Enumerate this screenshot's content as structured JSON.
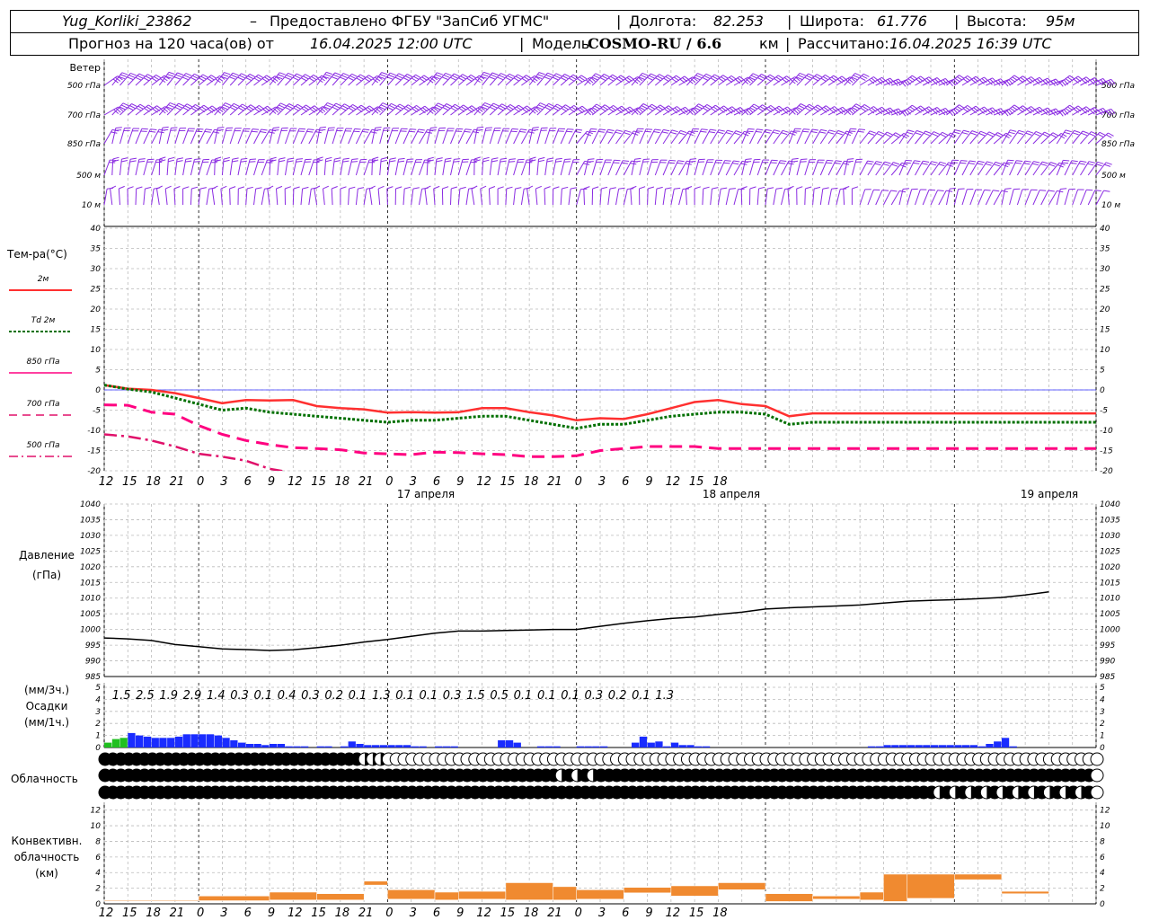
{
  "header": {
    "station": "Yug_Korliki_23862",
    "dash": "–",
    "provided_by": "Предоставлено ФГБУ \"ЗапСиб УГМС\"",
    "lon_label": "Долгота:",
    "lon_value": "82.253",
    "lat_label": "Широта:",
    "lat_value": "61.776",
    "alt_label": "Высота:",
    "alt_value": "95м",
    "forecast_label": "Прогноз на 120 часа(ов) от",
    "forecast_start": "16.04.2025 12:00 UTC",
    "model_label": "Модель",
    "model_name": "COSMO-RU / 6.6",
    "model_unit": "км",
    "computed_label": "Рассчитано:",
    "computed_value": "16.04.2025 16:39 UTC"
  },
  "colors": {
    "wind": "#8a2be2",
    "t2m": "#ff3030",
    "td2m": "#007000",
    "t850": "#ff0080",
    "t700": "#e0106a",
    "t500": "#e0106a",
    "pressure": "#000000",
    "precip_blue": "#1a2cff",
    "precip_green": "#20c020",
    "convective": "#f08a30",
    "grid": "#bbbbbb"
  },
  "chart_data": [
    {
      "type": "wind_barbs",
      "panel_label": "Ветер",
      "levels": [
        "500 гПа",
        "700 гПа",
        "850 гПа",
        "500 м",
        "10 м"
      ]
    },
    {
      "type": "line",
      "ylabel": "Тем-ра(°C)",
      "ylim": [
        -20,
        40
      ],
      "yticks": [
        40,
        35,
        30,
        25,
        20,
        15,
        10,
        5,
        0,
        -5,
        -10,
        -15,
        -20
      ],
      "x_hours": [
        0,
        3,
        6,
        9,
        12,
        15,
        18,
        21,
        24,
        27,
        30,
        33,
        36,
        39,
        42,
        45,
        48,
        51,
        54,
        57,
        60,
        63,
        66,
        69,
        72,
        75,
        78,
        81,
        84,
        87,
        90,
        93,
        96,
        99,
        102,
        105,
        108,
        111,
        114,
        117,
        120,
        123,
        126
      ],
      "series": [
        {
          "name": "2м",
          "style": "solid",
          "values": [
            1.2,
            0.3,
            0.0,
            -0.8,
            -2.0,
            -3.3,
            -2.5,
            -2.6,
            -2.5,
            -4.0,
            -4.5,
            -4.8,
            -5.6,
            -5.5,
            -5.6,
            -5.5,
            -4.5,
            -4.5,
            -5.5,
            -6.3,
            -7.5,
            -7.0,
            -7.2,
            -6.0,
            -4.5,
            -3.0,
            -2.5,
            -3.5,
            -4.0,
            -6.5,
            -5.8,
            -5.8,
            -5.8,
            -5.8,
            -5.8,
            -5.8,
            -5.8,
            -5.8,
            -5.8,
            -5.8,
            -5.8,
            -5.8,
            -5.8
          ]
        },
        {
          "name": "Td 2м",
          "style": "dotted",
          "values": [
            1.2,
            0.2,
            -0.5,
            -2.0,
            -3.5,
            -5.0,
            -4.5,
            -5.5,
            -6.0,
            -6.5,
            -7.0,
            -7.5,
            -8.0,
            -7.5,
            -7.5,
            -7.0,
            -6.5,
            -6.5,
            -7.5,
            -8.5,
            -9.5,
            -8.5,
            -8.5,
            -7.5,
            -6.5,
            -6.0,
            -5.5,
            -5.5,
            -6.0,
            -8.5,
            -8.0,
            -8.0,
            -8.0,
            -8.0,
            -8.0,
            -8.0,
            -8.0,
            -8.0,
            -8.0,
            -8.0,
            -8.0,
            -8.0,
            -8.0
          ]
        },
        {
          "name": "850 гПа",
          "style": "dashed",
          "values": [
            -3.7,
            -3.8,
            -5.5,
            -6.0,
            -8.8,
            -11.0,
            -12.5,
            -13.5,
            -14.3,
            -14.5,
            -14.8,
            -15.6,
            -15.8,
            -16.0,
            -15.4,
            -15.5,
            -15.8,
            -16.0,
            -16.5,
            -16.5,
            -16.3,
            -15.0,
            -14.5,
            -14.0,
            -14.0,
            -14.0,
            -14.5,
            -14.5,
            -14.5,
            -14.5,
            -14.5,
            -14.5,
            -14.5,
            -14.5,
            -14.5,
            -14.5,
            -14.5,
            -14.5,
            -14.5,
            -14.5,
            -14.5,
            -14.5,
            -14.5
          ]
        },
        {
          "name": "700 гПа",
          "style": "longdash",
          "values": [
            -11.0,
            -11.5,
            -12.5,
            -14.0,
            -15.8,
            -16.5,
            -17.5,
            -19.5,
            -20.5
          ]
        },
        {
          "name": "500 гПа",
          "style": "dashdot",
          "values": []
        }
      ]
    },
    {
      "type": "line",
      "ylabel": "Давление",
      "ylabel2": "(гПа)",
      "ylim": [
        985,
        1040
      ],
      "yticks": [
        1040,
        1035,
        1030,
        1025,
        1020,
        1015,
        1010,
        1005,
        1000,
        995,
        990,
        985
      ],
      "x_hours": [
        0,
        3,
        6,
        9,
        12,
        15,
        18,
        21,
        24,
        27,
        30,
        33,
        36,
        39,
        42,
        45,
        48,
        51,
        54,
        57,
        60,
        63,
        66,
        69,
        72,
        75,
        78,
        81,
        84,
        87,
        90,
        93,
        96,
        99,
        102,
        105,
        108,
        111,
        114,
        117,
        120
      ],
      "series": [
        {
          "name": "Давление",
          "values": [
            997.3,
            997.0,
            996.5,
            995.2,
            994.5,
            993.8,
            993.6,
            993.3,
            993.5,
            994.2,
            995.0,
            996.0,
            996.8,
            997.8,
            998.8,
            999.5,
            999.5,
            999.7,
            999.8,
            1000.0,
            1000.0,
            1001.0,
            1002.0,
            1002.8,
            1003.5,
            1004.0,
            1004.8,
            1005.5,
            1006.5,
            1006.9,
            1007.2,
            1007.5,
            1007.8,
            1008.4,
            1009.0,
            1009.3,
            1009.5,
            1009.8,
            1010.2,
            1011.0,
            1012.0
          ]
        }
      ]
    },
    {
      "type": "bar",
      "ylabel_3h": "(мм/3ч.)",
      "ylabel": "Осадки",
      "ylabel_1h": "(мм/1ч.)",
      "ylim": [
        0,
        5
      ],
      "yticks": [
        5,
        4,
        3,
        2,
        1,
        0
      ],
      "totals_3h": [
        "1.5",
        "2.5",
        "1.9",
        "2.9",
        "1.4",
        "0.3",
        "0.1",
        "0.4",
        "0.3",
        "0.2",
        "0.1",
        "1.3",
        "0.1",
        "0.1",
        "0.3",
        "1.5",
        "0.5",
        "0.1",
        "0.1",
        "0.1",
        "0.3",
        "0.2",
        "0.1",
        "1.3"
      ],
      "hourly_mm": [
        0.4,
        0.7,
        0.8,
        1.2,
        1.0,
        0.9,
        0.8,
        0.8,
        0.8,
        0.9,
        1.1,
        1.1,
        1.1,
        1.1,
        1.0,
        0.8,
        0.6,
        0.4,
        0.3,
        0.3,
        0.2,
        0.3,
        0.3,
        0.1,
        0.1,
        0.1,
        0.0,
        0.1,
        0.1,
        0.0,
        0.1,
        0.5,
        0.3,
        0.2,
        0.2,
        0.2,
        0.2,
        0.2,
        0.2,
        0.1,
        0.1,
        0.0,
        0.1,
        0.1,
        0.1,
        0.0,
        0.0,
        0.0,
        0.0,
        0.0,
        0.6,
        0.6,
        0.4,
        0.0,
        0.0,
        0.1,
        0.1,
        0.1,
        0.0,
        0.0,
        0.1,
        0.1,
        0.1,
        0.1,
        0.0,
        0.0,
        0.0,
        0.4,
        0.9,
        0.4,
        0.5,
        0.1,
        0.4,
        0.2,
        0.2,
        0.1,
        0.1,
        0.0,
        0.0,
        0.0,
        0.0,
        0.0,
        0.0,
        0.0,
        0.0,
        0.0,
        0.0,
        0.0,
        0.0,
        0.0,
        0.0,
        0.0,
        0.0,
        0.0,
        0.0,
        0.0,
        0.0,
        0.1,
        0.1,
        0.2,
        0.2,
        0.2,
        0.2,
        0.2,
        0.2,
        0.2,
        0.2,
        0.2,
        0.2,
        0.2,
        0.2,
        0.1,
        0.3,
        0.5,
        0.8,
        0.1,
        0.0,
        0.0,
        0.0,
        0.0,
        0.0
      ],
      "green_hours": [
        0,
        1,
        2
      ]
    },
    {
      "type": "symbols",
      "panel_label": "Облачность",
      "rows": 3
    },
    {
      "type": "bar",
      "ylabel": "Конвективн.",
      "ylabel2": "облачность",
      "ylabel3": "(км)",
      "ylim": [
        0,
        13
      ],
      "yticks": [
        12,
        10,
        8,
        6,
        4,
        2,
        0
      ],
      "segments_km": [
        [
          0,
          6,
          0.4,
          0.5
        ],
        [
          6,
          12,
          0.4,
          0.5
        ],
        [
          12,
          21,
          0.4,
          1.0
        ],
        [
          21,
          27,
          0.5,
          1.5
        ],
        [
          27,
          33,
          0.5,
          1.3
        ],
        [
          33,
          36,
          2.4,
          2.9
        ],
        [
          36,
          42,
          0.6,
          1.8
        ],
        [
          42,
          45,
          0.5,
          1.5
        ],
        [
          45,
          51,
          0.6,
          1.6
        ],
        [
          51,
          57,
          0.5,
          2.7
        ],
        [
          57,
          60,
          0.5,
          2.2
        ],
        [
          60,
          66,
          0.6,
          1.8
        ],
        [
          66,
          72,
          1.4,
          2.1
        ],
        [
          72,
          78,
          1.0,
          2.3
        ],
        [
          78,
          84,
          1.8,
          2.7
        ],
        [
          84,
          90,
          0.3,
          1.3
        ],
        [
          90,
          96,
          0.6,
          1.0
        ],
        [
          96,
          99,
          0.5,
          1.5
        ],
        [
          99,
          102,
          0.3,
          3.8
        ],
        [
          102,
          108,
          0.7,
          3.8
        ],
        [
          108,
          114,
          3.1,
          3.8
        ],
        [
          114,
          120,
          1.3,
          1.6
        ]
      ]
    }
  ],
  "x_axis": {
    "tick_labels": [
      "12",
      "15",
      "18",
      "21",
      "0",
      "3",
      "6",
      "9",
      "12",
      "15",
      "18",
      "21",
      "0",
      "3",
      "6",
      "9",
      "12",
      "15",
      "18",
      "21",
      "0",
      "3",
      "6",
      "9",
      "12",
      "15",
      "18"
    ],
    "dates": [
      "17 апреля",
      "18 апреля",
      "19 апреля"
    ]
  }
}
